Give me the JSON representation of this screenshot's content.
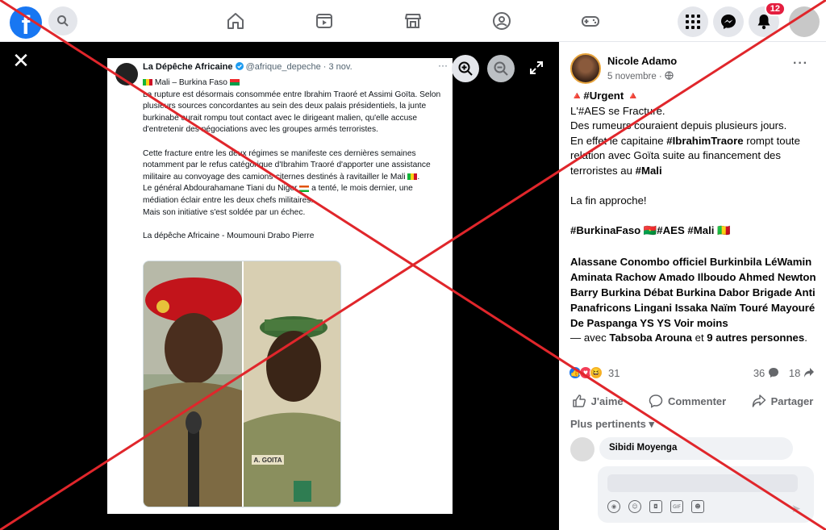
{
  "topbar": {
    "logo": "f",
    "notifications_count": "12",
    "icons": [
      "search-icon",
      "home-icon",
      "video-icon",
      "marketplace-icon",
      "groups-icon",
      "gaming-icon",
      "menu-grid-icon",
      "messenger-icon",
      "bell-icon"
    ]
  },
  "viewer": {
    "close": "✕"
  },
  "tweet": {
    "name": "La Dépêche Africaine",
    "handle": "@afrique_depeche · 3 nov.",
    "more": "···",
    "title": " Mali – Burkina Faso ",
    "p1": "La rupture est désormais consommée entre Ibrahim Traoré et Assimi Goïta. Selon plusieurs sources concordantes au sein des deux palais présidentiels, la junte burkinabè aurait rompu tout contact avec le dirigeant malien, qu'elle accuse d'entretenir des négociations avec les groupes armés terroristes.",
    "p2": "Cette fracture entre les deux régimes se manifeste ces dernières semaines notamment par le refus catégorique d'Ibrahim Traoré d'apporter une assistance militaire au convoyage des camions-citernes destinés à ravitailler le Mali ",
    "p3a": "Le général Abdourahamane Tiani du Niger ",
    "p3b": " a tenté, le mois dernier, une médiation éclair entre les deux chefs militaires.",
    "p4": "Mais son initiative s'est soldée par un échec.",
    "signature": "La dépêche Africaine - Moumouni Drabo Pierre",
    "nametag": "A. GOITA"
  },
  "post": {
    "author": "Nicole Adamo",
    "date": "5 novembre · ",
    "more": "···",
    "line1": "🔺#Urgent 🔺",
    "line2": "L'#AES se Fracture.",
    "line3": "Des rumeurs couraient depuis plusieurs jours.",
    "line4a": "En effet le capitaine ",
    "line4b": "#IbrahimTraore",
    "line4c": " rompt toute relation avec Goïta suite au financement des terroristes au ",
    "line4d": "#Mali",
    "line5": "La fin approche!",
    "tags": "#BurkinaFaso 🇧🇫#AES #Mali 🇲🇱",
    "people": "Alassane Conombo officiel Burkinbila LéWamin Aminata Rachow Amado Ilboudo Ahmed Newton Barry Burkina Débat Burkina Dabor Brigade Anti Panafricons Lingani Issaka Naïm Touré Mayouré De Paspanga YS YS Voir moins",
    "with_prefix": "— avec ",
    "with_name": "Tabsoba Arouna",
    "with_mid": " et ",
    "with_others": "9 autres personnes",
    "with_end": "."
  },
  "stats": {
    "reactions": "31",
    "comments": "36",
    "shares": "18"
  },
  "actions": {
    "like": "J'aime",
    "comment": "Commenter",
    "share": "Partager"
  },
  "comments": {
    "filter": "Plus pertinents",
    "first_author": "Sibidi Moyenga"
  },
  "colors": {
    "facebook_blue": "#1877f2",
    "overlay_red": "#e0262b",
    "badge_red": "#e41e3f"
  }
}
